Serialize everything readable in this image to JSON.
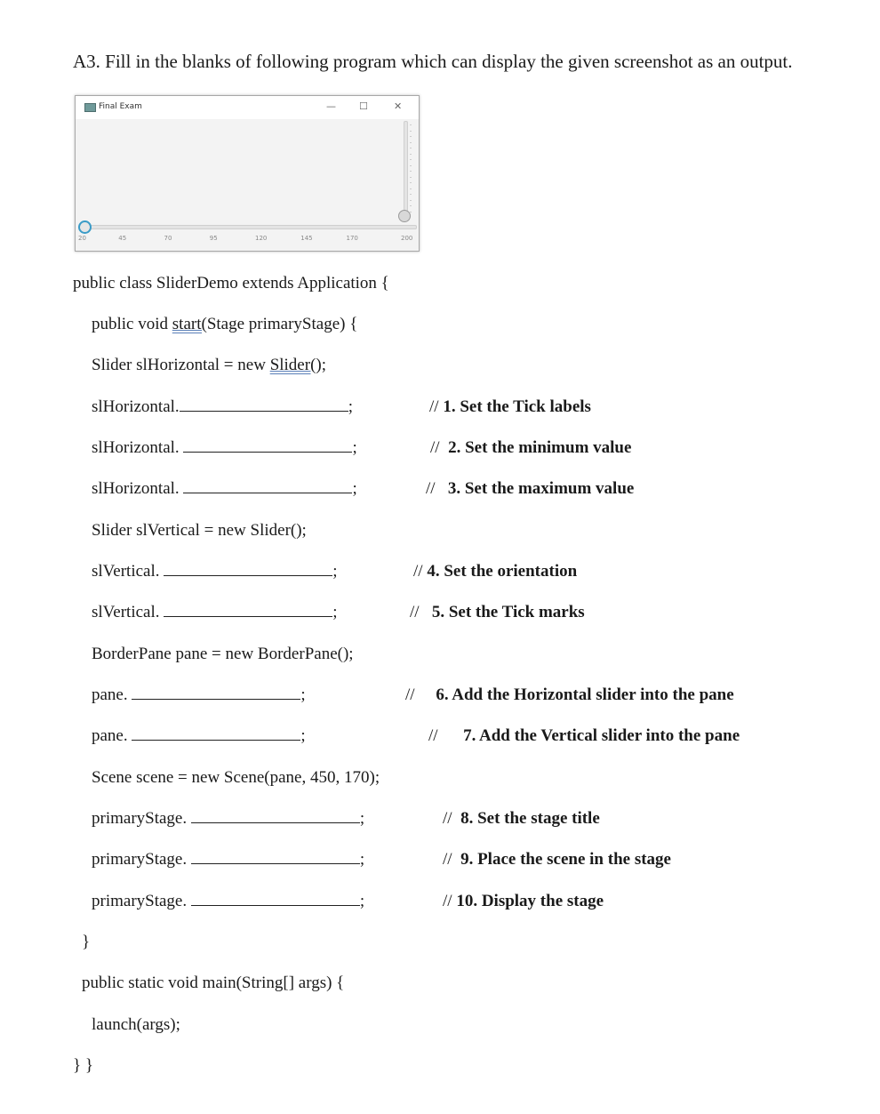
{
  "question": "A3. Fill in the blanks of following program which can display the given screenshot as an output.",
  "window": {
    "title": "Final Exam",
    "minimize_glyph": "—",
    "maximize_glyph": "☐",
    "close_glyph": "✕",
    "horizontal_slider": {
      "min": 20,
      "max": 200,
      "value": 20,
      "tick_labels": [
        "20",
        "45",
        "70",
        "95",
        "120",
        "145",
        "170",
        "200"
      ]
    },
    "vertical_slider": {
      "value_fraction": 0
    }
  },
  "code": {
    "class_decl": "public class SliderDemo extends Application {",
    "start_pre": "public void ",
    "start_link": "start(",
    "start_post": "Stage primaryStage) {",
    "slider_h_pre": "Slider slHorizontal = new ",
    "slider_h_link": "Slider(",
    "slider_h_post": ");",
    "line_h1": "slHorizontal.",
    "line_h2": "slHorizontal. ",
    "line_h3": "slHorizontal. ",
    "slider_v": "Slider slVertical = new Slider();",
    "line_v1": "slVertical. ",
    "line_v2": "slVertical. ",
    "pane_decl": "BorderPane pane = new BorderPane();",
    "line_p1": "pane. ",
    "line_p2": "pane. ",
    "scene_decl": "Scene scene = new Scene(pane, 450, 170);",
    "line_s1": "primaryStage. ",
    "line_s2": "primaryStage. ",
    "line_s3": "primaryStage. ",
    "semicolon": ";",
    "close_method": "}",
    "main_decl": "public static void main(String[] args) {",
    "launch": "launch(args);",
    "close_class": "} }"
  },
  "comments": {
    "slashes": "//",
    "c1": "1. Set the Tick labels",
    "c2": "2. Set the minimum value",
    "c3": "3. Set the maximum value",
    "c4": "4. Set the orientation",
    "c5": "5. Set the Tick marks",
    "c6": "6. Add the Horizontal slider into the pane",
    "c7": "7. Add the Vertical slider into the pane",
    "c8": "8. Set the stage title",
    "c9": "9. Place the scene in the stage",
    "c10": "10. Display the stage"
  }
}
